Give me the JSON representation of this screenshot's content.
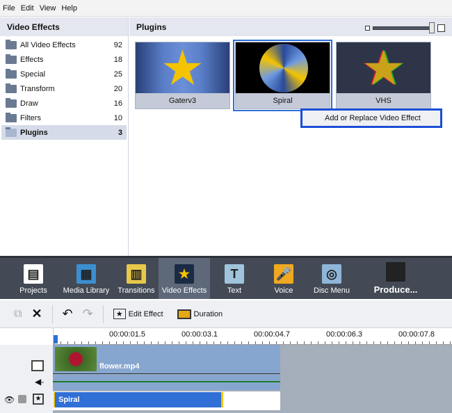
{
  "menu": [
    "File",
    "Edit",
    "View",
    "Help"
  ],
  "left_panel": {
    "title": "Video Effects",
    "categories": [
      {
        "label": "All Video Effects",
        "count": "92"
      },
      {
        "label": "Effects",
        "count": "18"
      },
      {
        "label": "Special",
        "count": "25"
      },
      {
        "label": "Transform",
        "count": "20"
      },
      {
        "label": "Draw",
        "count": "16"
      },
      {
        "label": "Filters",
        "count": "10"
      },
      {
        "label": "Plugins",
        "count": "3"
      }
    ]
  },
  "right_panel": {
    "title": "Plugins",
    "effects": [
      "Gaterv3",
      "Spiral",
      "VHS"
    ],
    "zoom_level": 1.0
  },
  "context_menu": {
    "item": "Add or Replace Video Effect"
  },
  "tabs": [
    "Projects",
    "Media Library",
    "Transitions",
    "Video Effects",
    "Text",
    "Voice",
    "Disc Menu",
    "Produce..."
  ],
  "edit_toolbar": {
    "edit_effect": "Edit Effect",
    "duration": "Duration"
  },
  "ruler": [
    "00:00:01.5",
    "00:00:03.1",
    "00:00:04.7",
    "00:00:06.3",
    "00:00:07.8"
  ],
  "timeline": {
    "video_clip": "flower.mp4",
    "effect_clip": "Spiral"
  },
  "colors": {
    "accent": "#2d6fd8",
    "tabbar": "#434a56"
  }
}
